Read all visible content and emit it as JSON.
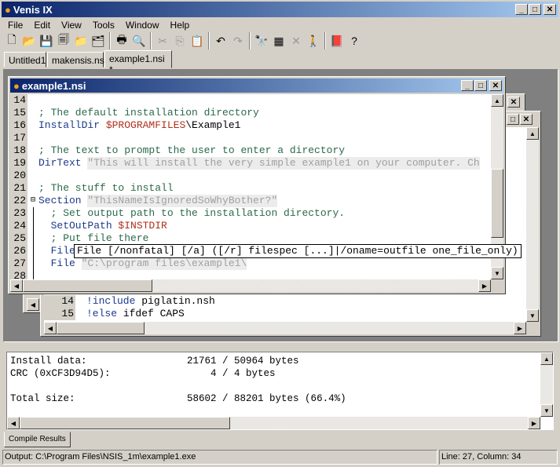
{
  "app": {
    "title": "Venis IX"
  },
  "menu": [
    "File",
    "Edit",
    "View",
    "Tools",
    "Window",
    "Help"
  ],
  "toolbar": [
    {
      "icon": "new-file-icon",
      "g": "🗋"
    },
    {
      "icon": "open-folder-icon",
      "g": "📂"
    },
    {
      "icon": "save-icon",
      "g": "💾"
    },
    {
      "icon": "save-all-icon",
      "g": "🗐"
    },
    {
      "icon": "open-project-icon",
      "g": "📁"
    },
    {
      "icon": "save-project-icon",
      "g": "🗂"
    },
    {
      "icon": "print-icon",
      "g": "🖶"
    },
    {
      "icon": "print-preview-icon",
      "g": "🔍"
    },
    {
      "icon": "cut-icon",
      "g": "✂"
    },
    {
      "icon": "copy-icon",
      "g": "⎘"
    },
    {
      "icon": "paste-icon",
      "g": "📋"
    },
    {
      "icon": "undo-icon",
      "g": "↶"
    },
    {
      "icon": "redo-icon",
      "g": "↷"
    },
    {
      "icon": "find-icon",
      "g": "🔭"
    },
    {
      "icon": "compile-icon",
      "g": "▦"
    },
    {
      "icon": "stop-icon",
      "g": "✕"
    },
    {
      "icon": "run-icon",
      "g": "🚶"
    },
    {
      "icon": "help-book-icon",
      "g": "📕"
    },
    {
      "icon": "help-icon",
      "g": "?"
    }
  ],
  "tabs": [
    {
      "label": "Untitled1"
    },
    {
      "label": "makensis.nsi"
    },
    {
      "label": "example1.nsi *",
      "active": true
    }
  ],
  "editor": {
    "title": "example1.nsi",
    "lines": [
      {
        "n": "14",
        "t": []
      },
      {
        "n": "15",
        "t": [
          [
            "c",
            "; The default installation directory"
          ]
        ]
      },
      {
        "n": "16",
        "t": [
          [
            "k",
            "InstallDir "
          ],
          [
            "v",
            "$PROGRAMFILES"
          ],
          [
            "",
            "\\Example1"
          ]
        ]
      },
      {
        "n": "17",
        "t": []
      },
      {
        "n": "18",
        "t": [
          [
            "c",
            "; The text to prompt the user to enter a directory"
          ]
        ]
      },
      {
        "n": "19",
        "t": [
          [
            "k",
            "DirText "
          ],
          [
            "s",
            "\"This will install the very simple example1 on your computer. Ch"
          ]
        ]
      },
      {
        "n": "20",
        "t": []
      },
      {
        "n": "21",
        "t": [
          [
            "c",
            "; The stuff to install"
          ]
        ]
      },
      {
        "n": "22",
        "t": [
          [
            "k",
            "Section "
          ],
          [
            "s",
            "\"ThisNameIsIgnoredSoWhyBother?\""
          ]
        ]
      },
      {
        "n": "23",
        "t": [
          [
            "c",
            "  ; Set output path to the installation directory."
          ]
        ]
      },
      {
        "n": "24",
        "t": [
          [
            "k",
            "  SetOutPath "
          ],
          [
            "v",
            "$INSTDIR"
          ]
        ]
      },
      {
        "n": "25",
        "t": [
          [
            "c",
            "  ; Put file there"
          ]
        ]
      },
      {
        "n": "26",
        "t": [
          [
            "k",
            "  File"
          ]
        ]
      },
      {
        "n": "27",
        "t": [
          [
            "k",
            "  File "
          ],
          [
            "s",
            "\"C:\\program files\\example1\\"
          ]
        ]
      },
      {
        "n": "28",
        "t": []
      }
    ],
    "calltip": "File [/nonfatal] [/a] ([/r] filespec [...]|/oname=outfile one_file_only)"
  },
  "back_editor": {
    "lines": [
      {
        "n": "14",
        "t": [
          [
            "k",
            "!include "
          ],
          [
            "",
            "piglatin.nsh"
          ]
        ]
      },
      {
        "n": "15",
        "t": [
          [
            "k",
            "!else "
          ],
          [
            "",
            "ifdef CAPS"
          ]
        ]
      }
    ]
  },
  "output": {
    "lines": [
      "Install data:                 21761 / 50964 bytes",
      "CRC (0xCF3D94D5):                 4 / 4 bytes",
      "",
      "Total size:                   58602 / 88201 bytes (66.4%)"
    ],
    "tab": "Compile Results"
  },
  "status": {
    "output": "Output: C:\\Program Files\\NSIS_1m\\example1.exe",
    "position": "Line: 27, Column: 34"
  }
}
